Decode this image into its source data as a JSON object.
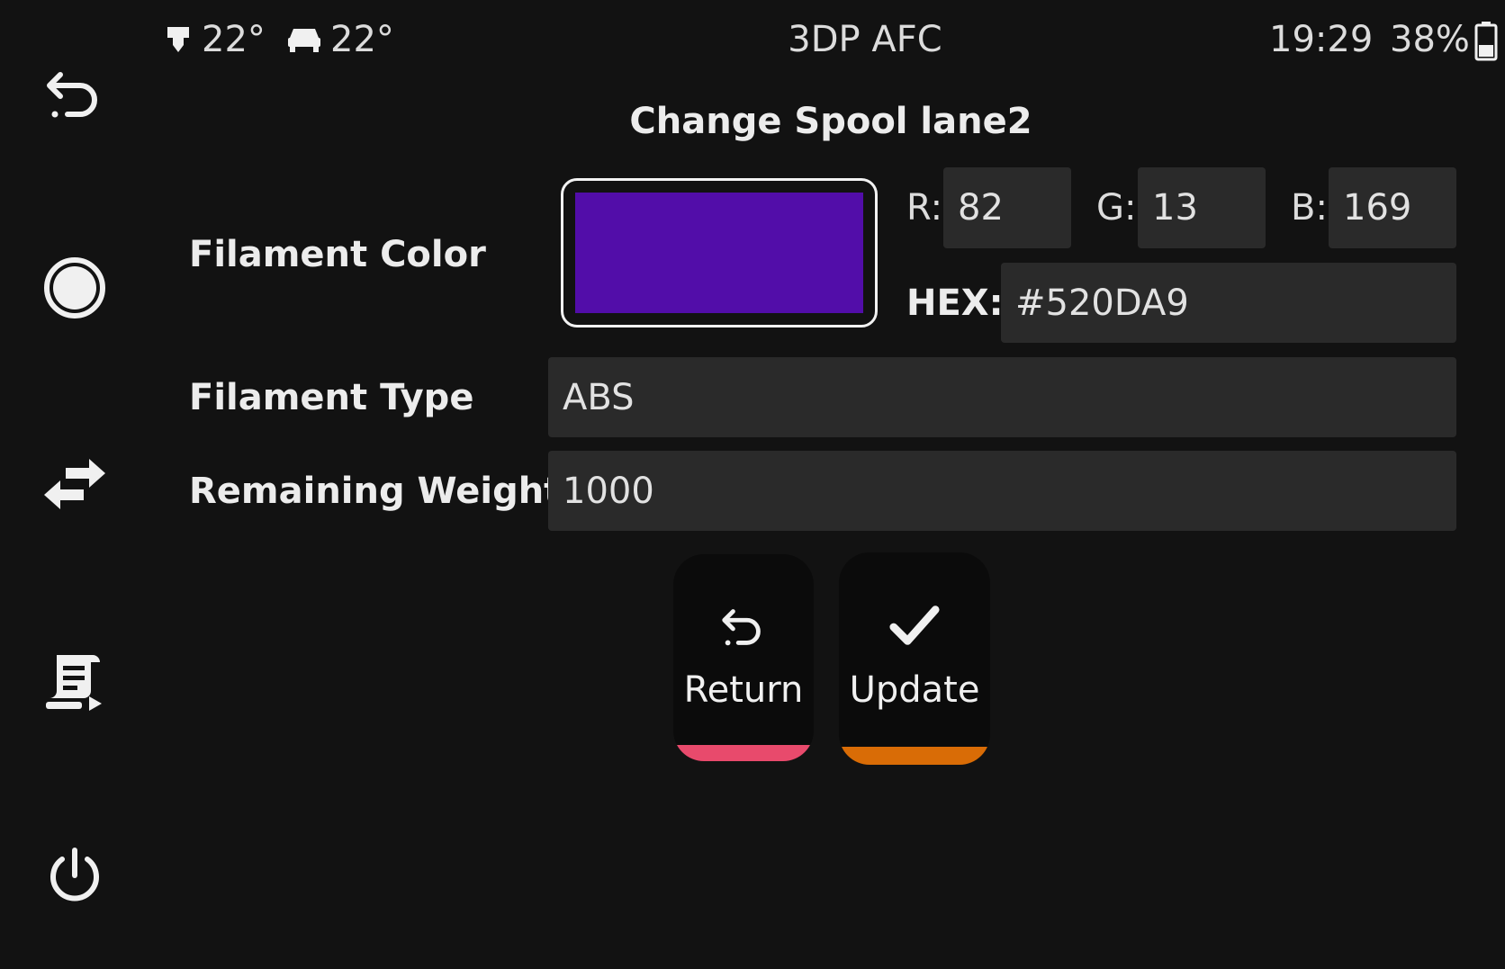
{
  "topbar": {
    "extruder_temp": "22°",
    "bed_temp": "22°",
    "title": "3DP AFC",
    "time": "19:29",
    "battery": "38%"
  },
  "sidebar": {
    "items": [
      {
        "name": "back",
        "icon": "undo-arrow-icon"
      },
      {
        "name": "home",
        "icon": "circle-icon"
      },
      {
        "name": "swap",
        "icon": "swap-arrows-icon"
      },
      {
        "name": "print",
        "icon": "print-queue-icon"
      },
      {
        "name": "power",
        "icon": "power-icon"
      }
    ]
  },
  "panel": {
    "title": "Change Spool lane2",
    "filament_color_label": "Filament Color",
    "filament_type_label": "Filament Type",
    "remaining_weight_label": "Remaining Weight",
    "color": {
      "swatch_hex": "#520DA9",
      "r_label": "R:",
      "r_value": "82",
      "g_label": "G:",
      "g_value": "13",
      "b_label": "B:",
      "b_value": "169",
      "hex_label": "HEX:",
      "hex_value": "#520DA9"
    },
    "filament_type_value": "ABS",
    "remaining_weight_value": "1000"
  },
  "actions": {
    "return_label": "Return",
    "return_accent": "#e84a6c",
    "update_label": "Update",
    "update_accent": "#d96c06"
  }
}
